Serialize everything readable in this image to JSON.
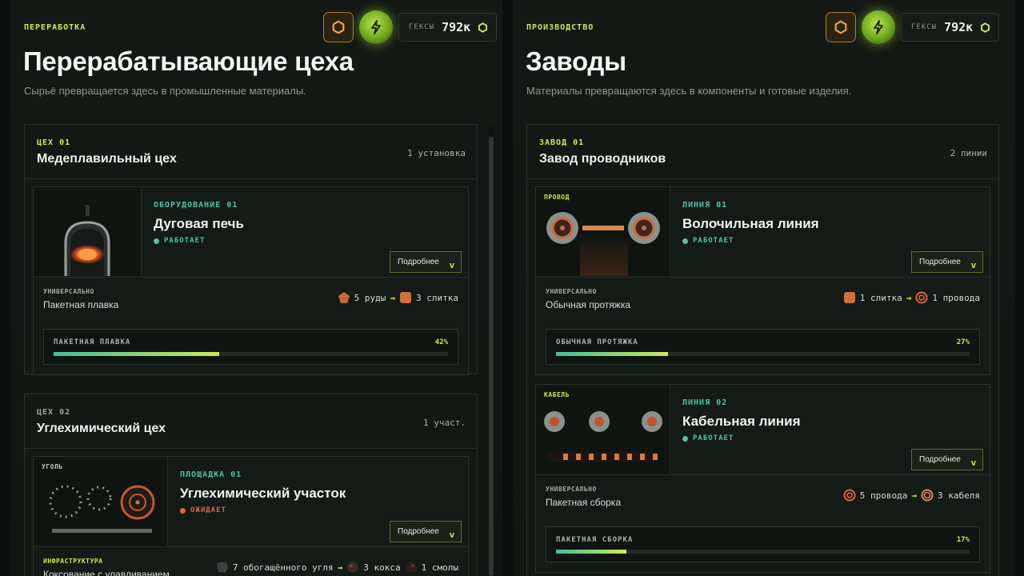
{
  "hud": {
    "currency_label": "ГЕКСЫ",
    "currency_value": "792к",
    "hex_icon": "hexagon-icon",
    "energy_icon": "lightning-bolt-icon"
  },
  "left": {
    "eyebrow": "ПЕРЕРАБОТКА",
    "title": "Перерабатывающие цеха",
    "subtitle": "Сырьё превращается здесь в промышленные материалы.",
    "workshops": [
      {
        "code": "ЦЕХ 01",
        "title": "Медеплавильный цех",
        "count": "1 установка",
        "unit": {
          "image_tag": "",
          "code": "ОБОРУДОВАНИЕ 01",
          "title": "Дуговая печь",
          "status": "РАБОТАЕТ",
          "status_color": "#4fc3a4",
          "more": "Подробнее",
          "recipe_tag": "УНИВЕРСАЛЬНО",
          "recipe_name": "Пакетная плавка",
          "input": "5 руды",
          "output": "3 слитка",
          "progress_label": "ПАКЕТНАЯ ПЛАВКА",
          "progress_text": "42%",
          "progress": 0.42
        }
      },
      {
        "code": "ЦЕХ 02",
        "title": "Углехимический цех",
        "count": "1 участ.",
        "unit": {
          "image_tag": "УГОЛЬ",
          "code": "ПЛОЩАДКА 01",
          "title": "Углехимический участок",
          "status": "ОЖИДАЕТ",
          "status_color": "#e0663c",
          "more": "Подробнее",
          "recipe_tag": "ИНФРАСТРУКТУРА",
          "recipe_name": "Коксование с улавливанием",
          "input": "7 обогащённого угля",
          "output": "3 кокса",
          "output2": "1 смолы"
        }
      }
    ]
  },
  "right": {
    "eyebrow": "ПРОИЗВОДСТВО",
    "title": "Заводы",
    "subtitle": "Материалы превращаются здесь в компоненты и готовые изделия.",
    "factory": {
      "code": "ЗАВОД 01",
      "title": "Завод проводников",
      "count": "2 линии",
      "lines": [
        {
          "image_tag": "ПРОВОД",
          "code": "ЛИНИЯ 01",
          "title": "Волочильная линия",
          "status": "РАБОТАЕТ",
          "status_color": "#4fc3a4",
          "more": "Подробнее",
          "recipe_tag": "УНИВЕРСАЛЬНО",
          "recipe_name": "Обычная протяжка",
          "input": "1 слитка",
          "output": "1 провода",
          "progress_label": "ОБЫЧНАЯ ПРОТЯЖКА",
          "progress_text": "27%",
          "progress": 0.27
        },
        {
          "image_tag": "КАБЕЛЬ",
          "code": "ЛИНИЯ 02",
          "title": "Кабельная линия",
          "status": "РАБОТАЕТ",
          "status_color": "#4fc3a4",
          "more": "Подробнее",
          "recipe_tag": "УНИВЕРСАЛЬНО",
          "recipe_name": "Пакетная сборка",
          "input": "5 провода",
          "output": "3 кабеля",
          "progress_label": "ПАКЕТНАЯ СБОРКА",
          "progress_text": "17%",
          "progress": 0.17
        }
      ]
    }
  }
}
